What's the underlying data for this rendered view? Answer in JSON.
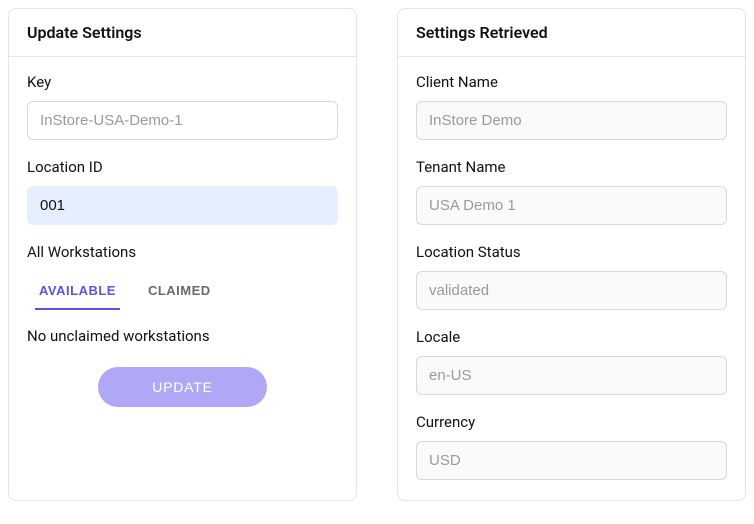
{
  "left": {
    "title": "Update Settings",
    "key": {
      "label": "Key",
      "placeholder": "InStore-USA-Demo-1"
    },
    "locationId": {
      "label": "Location ID",
      "value": "001"
    },
    "workstations": {
      "label": "All Workstations",
      "tabs": {
        "available": "AVAILABLE",
        "claimed": "CLAIMED"
      },
      "emptyMessage": "No unclaimed workstations"
    },
    "updateButton": "UPDATE"
  },
  "right": {
    "title": "Settings Retrieved",
    "clientName": {
      "label": "Client Name",
      "value": "InStore Demo"
    },
    "tenantName": {
      "label": "Tenant Name",
      "value": "USA Demo 1"
    },
    "locationStatus": {
      "label": "Location Status",
      "value": "validated"
    },
    "locale": {
      "label": "Locale",
      "value": "en-US"
    },
    "currency": {
      "label": "Currency",
      "value": "USD"
    }
  }
}
